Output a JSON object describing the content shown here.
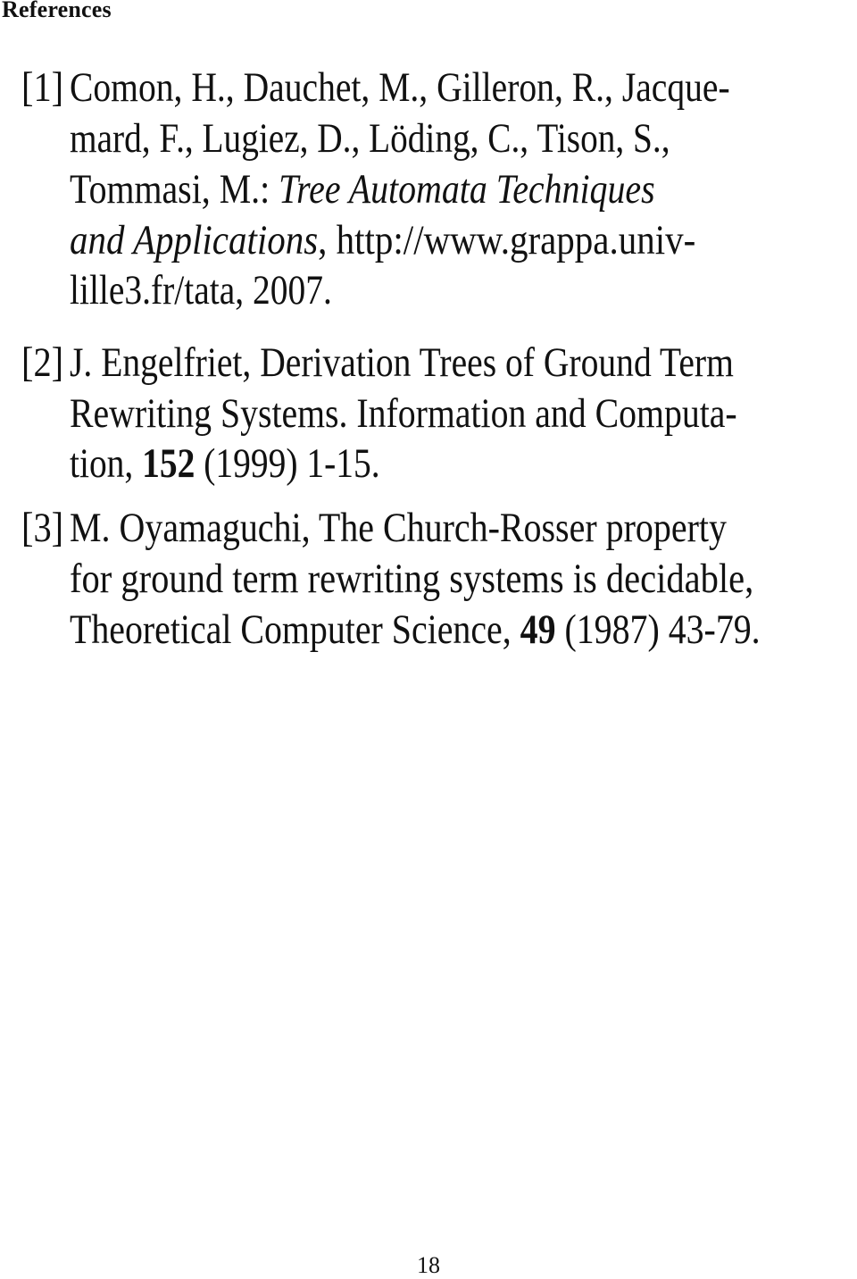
{
  "section_title": "References",
  "references": [
    {
      "number": "[1]",
      "lines": [
        "Comon, H., Dauchet, M., Gilleron, R., Jacque-",
        "mard, F., Lugiez, D., Löding, C., Tison, S.,",
        {
          "pre": "Tommasi, M.: ",
          "italic": "Tree Automata Techniques"
        },
        {
          "italic": "and Applications",
          "post": ", http://www.grappa.univ-"
        },
        "lille3.fr/tata, 2007."
      ]
    },
    {
      "number": "[2]",
      "lines": [
        "J. Engelfriet, Derivation Trees of Ground Term",
        "Rewriting Systems. Information and Computa-",
        {
          "pre": "tion, ",
          "bold": "152",
          "post": " (1999) 1-15."
        }
      ]
    },
    {
      "number": "[3]",
      "lines": [
        "M. Oyamaguchi, The Church-Rosser property",
        "for ground term rewriting systems is decidable,",
        {
          "pre": "Theoretical Computer Science, ",
          "bold": "49",
          "post": " (1987) 43-79."
        }
      ]
    }
  ],
  "page_number": "18"
}
